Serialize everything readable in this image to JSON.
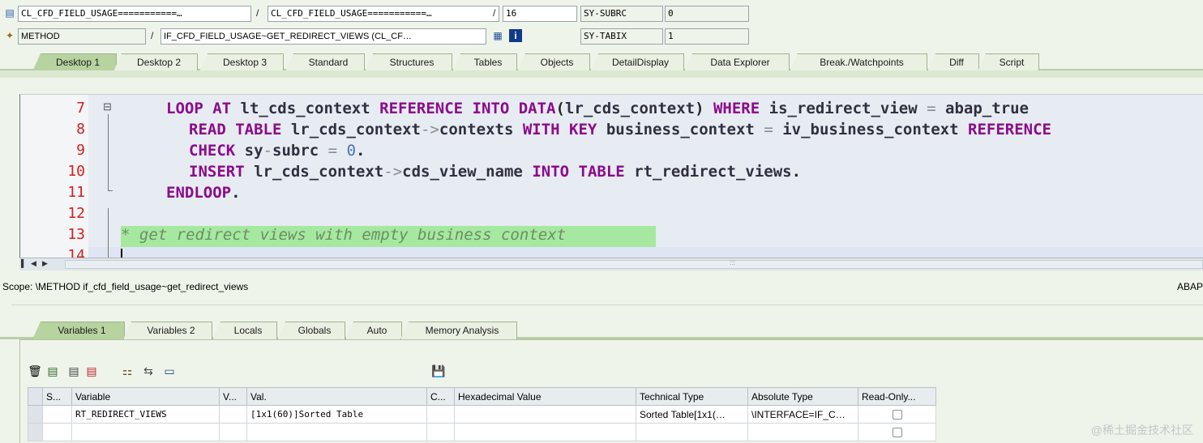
{
  "header": {
    "row1": {
      "program": "CL_CFD_FIELD_USAGE===========…",
      "include": "CL_CFD_FIELD_USAGE===========…",
      "line": "16",
      "sysfield_name": "SY-SUBRC",
      "sysfield_value": "0"
    },
    "row2": {
      "event_type": "METHOD",
      "event": "IF_CFD_FIELD_USAGE~GET_REDIRECT_VIEWS (CL_CF…",
      "sysfield_name": "SY-TABIX",
      "sysfield_value": "1"
    }
  },
  "tabs": [
    {
      "label": "Desktop 1",
      "active": true
    },
    {
      "label": "Desktop 2"
    },
    {
      "label": "Desktop 3"
    },
    {
      "label": "Standard"
    },
    {
      "label": "Structures"
    },
    {
      "label": "Tables"
    },
    {
      "label": "Objects"
    },
    {
      "label": "DetailDisplay"
    },
    {
      "label": "Data Explorer"
    },
    {
      "label": "Break./Watchpoints"
    },
    {
      "label": "Diff"
    },
    {
      "label": "Script"
    }
  ],
  "editor": {
    "line_numbers": [
      "7",
      "8",
      "9",
      "10",
      "11",
      "12",
      "13",
      "14"
    ]
  },
  "scope": {
    "text": "Scope: \\METHOD if_cfd_field_usage~get_redirect_views",
    "right": "ABAP"
  },
  "var_tabs": [
    {
      "label": "Variables 1",
      "active": true
    },
    {
      "label": "Variables 2"
    },
    {
      "label": "Locals"
    },
    {
      "label": "Globals"
    },
    {
      "label": "Auto"
    },
    {
      "label": "Memory Analysis"
    }
  ],
  "grid": {
    "headers": [
      "S...",
      "Variable",
      "V...",
      "Val.",
      "C...",
      "Hexadecimal Value",
      "Technical Type",
      "Absolute Type",
      "Read-Only..."
    ],
    "rows": [
      {
        "variable": "RT_REDIRECT_VIEWS",
        "value": "[1x1(60)]Sorted Table",
        "tech_type": "Sorted Table[1x1(…",
        "abs_type": "\\INTERFACE=IF_C…"
      }
    ]
  },
  "watermark": "@稀土掘金技术社区",
  "colors": {
    "keyword": "#8c0a8c",
    "line_number": "#d22020",
    "comment_highlight": "#a6e8a0",
    "tab_active": "#b7d3a0"
  }
}
